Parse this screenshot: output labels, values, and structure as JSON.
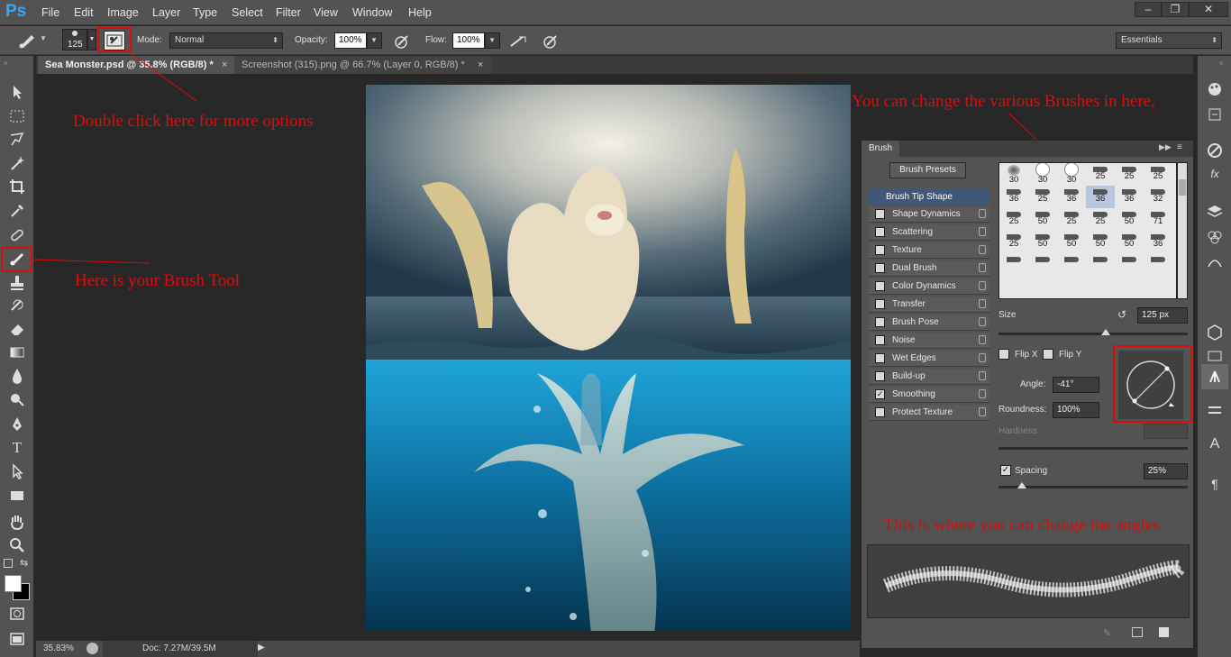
{
  "app": {
    "logo": "Ps"
  },
  "menu": [
    "File",
    "Edit",
    "Image",
    "Layer",
    "Type",
    "Select",
    "Filter",
    "View",
    "Window",
    "Help"
  ],
  "window_controls": [
    "–",
    "❐",
    "✕"
  ],
  "options": {
    "size": "125",
    "mode_label": "Mode:",
    "mode_value": "Normal",
    "opacity_label": "Opacity:",
    "opacity_value": "100%",
    "flow_label": "Flow:",
    "flow_value": "100%",
    "workspace": "Essentials"
  },
  "tabs": [
    {
      "label": "Sea Monster.psd @ 35.8% (RGB/8) *",
      "active": true
    },
    {
      "label": "Screenshot (315).png @ 66.7% (Layer 0, RGB/8) *",
      "active": false
    }
  ],
  "tab_close": "×",
  "status": {
    "zoom": "35.83%",
    "doc": "Doc: 7.27M/39.5M"
  },
  "brush_panel": {
    "tab": "Brush",
    "presets_button": "Brush Presets",
    "tip_shape": "Brush Tip Shape",
    "options": [
      {
        "label": "Shape Dynamics",
        "checked": false
      },
      {
        "label": "Scattering",
        "checked": false
      },
      {
        "label": "Texture",
        "checked": false
      },
      {
        "label": "Dual Brush",
        "checked": false
      },
      {
        "label": "Color Dynamics",
        "checked": false
      },
      {
        "label": "Transfer",
        "checked": false
      },
      {
        "label": "Brush Pose",
        "checked": false
      },
      {
        "label": "Noise",
        "checked": false
      },
      {
        "label": "Wet Edges",
        "checked": false
      },
      {
        "label": "Build-up",
        "checked": false
      },
      {
        "label": "Smoothing",
        "checked": true
      },
      {
        "label": "Protect Texture",
        "checked": false
      }
    ],
    "preset_sizes": [
      [
        "30",
        "30",
        "30",
        "25",
        "25",
        "25"
      ],
      [
        "36",
        "25",
        "36",
        "36",
        "36",
        "32"
      ],
      [
        "25",
        "50",
        "25",
        "25",
        "50",
        "71"
      ],
      [
        "25",
        "50",
        "50",
        "50",
        "50",
        "36"
      ],
      [
        "",
        "",
        "",
        "",
        "",
        ""
      ]
    ],
    "size_label": "Size",
    "size_value": "125 px",
    "flipx": "Flip X",
    "flipy": "Flip Y",
    "angle_label": "Angle:",
    "angle_value": "-41°",
    "roundness_label": "Roundness:",
    "roundness_value": "100%",
    "hardness_label": "Hardness",
    "spacing_label": "Spacing",
    "spacing_value": "25%",
    "spacing_checked": true
  },
  "annotations": {
    "double_click": "Double click here for more options",
    "brush_tool": "Here is your Brush Tool",
    "brushes": "You can change the various Brushes in here,",
    "angles": "This is where you can change the angles"
  },
  "colors": {
    "accent": "#31a8ff",
    "annotation": "#e00a0a",
    "panel": "#535353"
  }
}
